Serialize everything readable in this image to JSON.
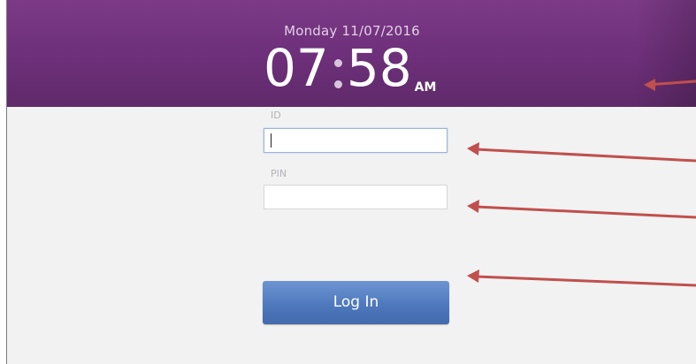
{
  "header": {
    "date": "Monday 11/07/2016",
    "time_hours": "07",
    "time_minutes": "58",
    "time_ampm": "AM"
  },
  "form": {
    "id_label": "ID",
    "id_value": "",
    "pin_label": "PIN",
    "pin_value": ""
  },
  "login_button": {
    "label": "Log In"
  },
  "colors": {
    "header_purple": "#6d2f79",
    "button_blue": "#4f79bd",
    "annotation_arrow": "#c0504d",
    "background": "#f2f2f3"
  },
  "annotations": {
    "arrow_count": 4
  }
}
